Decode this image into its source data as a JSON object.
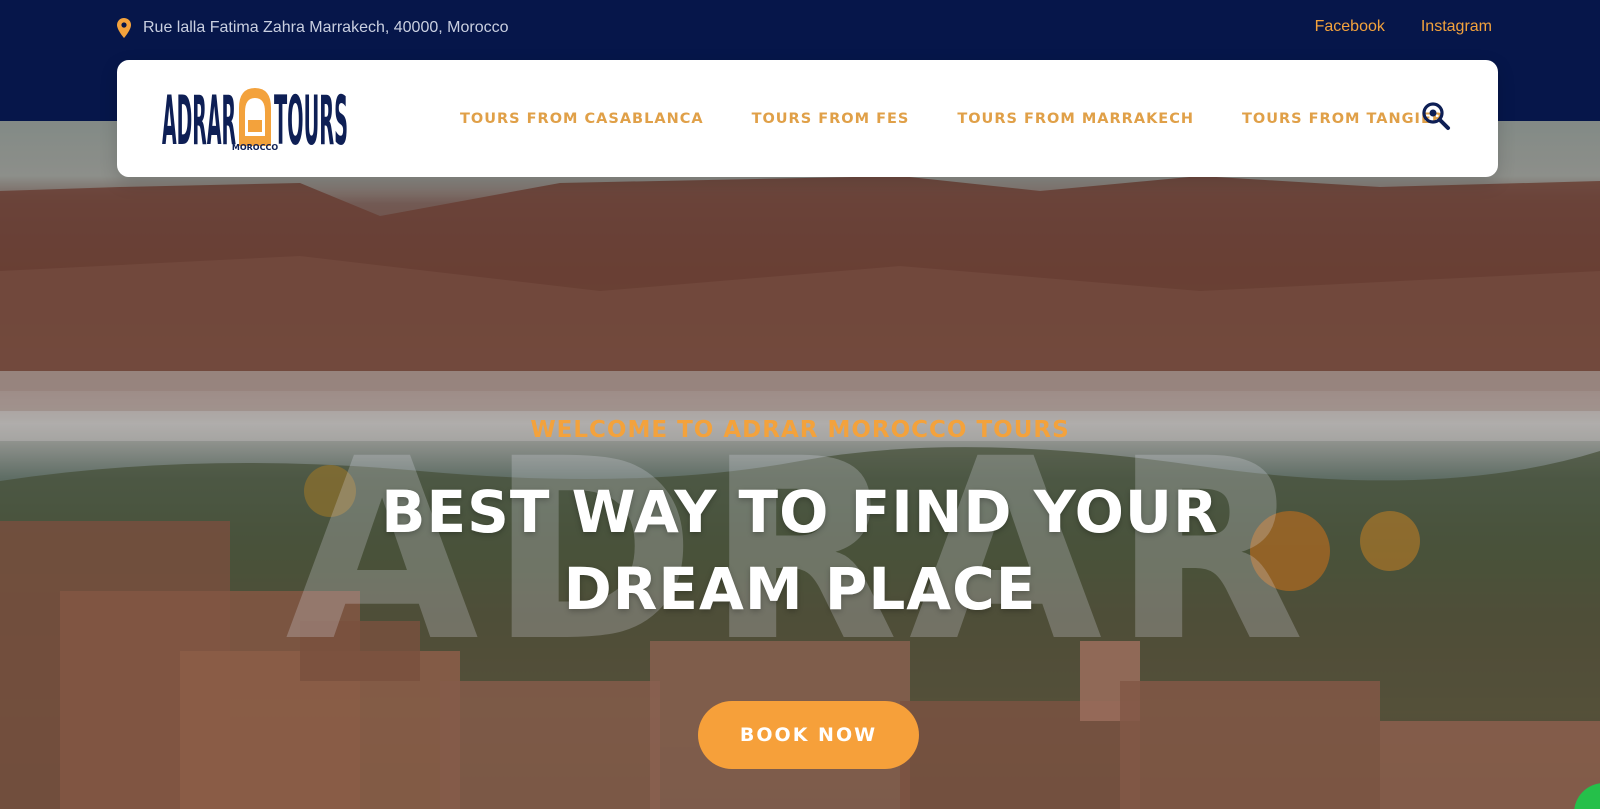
{
  "topbar": {
    "address": "Rue lalla Fatima Zahra Marrakech, 40000, Morocco",
    "address_icon": "map-pin-icon",
    "social": [
      {
        "label": "Facebook"
      },
      {
        "label": "Instagram"
      }
    ]
  },
  "header": {
    "logo": {
      "word_left": "ADRAR",
      "word_right": "TOURS",
      "sub": "MOROCCO"
    },
    "nav": [
      {
        "label": "TOURS FROM CASABLANCA"
      },
      {
        "label": "TOURS FROM FES"
      },
      {
        "label": "TOURS FROM MARRAKECH"
      },
      {
        "label": "TOURS FROM TANGIER"
      }
    ],
    "search_icon": "search-icon"
  },
  "hero": {
    "watermark": "ADRAR",
    "subtitle": "WELCOME TO ADRAR MOROCCO TOURS",
    "title_line1": "BEST WAY TO FIND YOUR",
    "title_line2": "DREAM PLACE",
    "cta": "BOOK NOW"
  },
  "colors": {
    "topbar_bg": "#06164a",
    "accent": "#f3a23c",
    "nav_text": "#e0a048",
    "logo_navy": "#0e1f55",
    "chat_green": "#25c04a"
  }
}
